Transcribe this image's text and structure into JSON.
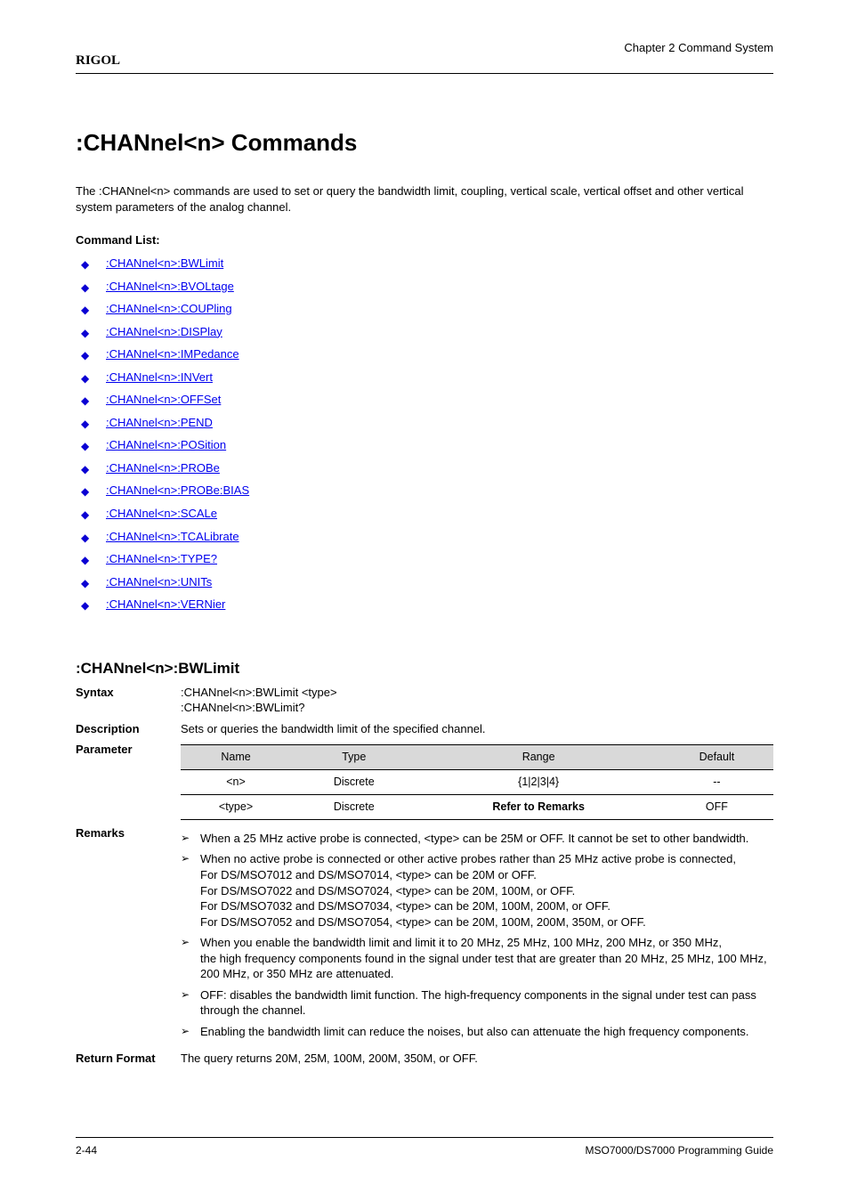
{
  "header": {
    "brand": "RIGOL",
    "chapterLabel": "Chapter 2 Command System"
  },
  "section": {
    "title": ":CHANnel<n> Commands",
    "intro": "The :CHANnel<n> commands are used to set or query the bandwidth limit, coupling, vertical scale, vertical offset and other vertical system parameters of the analog channel."
  },
  "linkHeading": "Command List:",
  "links": [
    ":CHANnel<n>:BWLimit",
    ":CHANnel<n>:BVOLtage",
    ":CHANnel<n>:COUPling",
    ":CHANnel<n>:DISPlay",
    ":CHANnel<n>:IMPedance",
    ":CHANnel<n>:INVert",
    ":CHANnel<n>:OFFSet",
    ":CHANnel<n>:PEND",
    ":CHANnel<n>:POSition",
    ":CHANnel<n>:PROBe",
    ":CHANnel<n>:PROBe:BIAS",
    ":CHANnel<n>:SCALe",
    ":CHANnel<n>:TCALibrate",
    ":CHANnel<n>:TYPE?",
    ":CHANnel<n>:UNITs",
    ":CHANnel<n>:VERNier"
  ],
  "cmdSection": {
    "title": ":CHANnel<n>:BWLimit",
    "syntaxLabel": "Syntax",
    "syntax1": ":CHANnel<n>:BWLimit <type>",
    "syntax2": ":CHANnel<n>:BWLimit?",
    "descLabel": "Description",
    "description": "Sets or queries the bandwidth limit of the specified channel.",
    "paramLabel": "Parameter",
    "paramTable": {
      "headers": [
        "Name",
        "Type",
        "Range",
        "Default"
      ],
      "rows": [
        [
          "<n>",
          "Discrete",
          "{1|2|3|4}",
          "--"
        ],
        [
          "<type>",
          "Discrete",
          "Refer to Remarks",
          "OFF"
        ]
      ]
    },
    "remarksLabel": "Remarks",
    "remarksBullets": [
      "When a 25 MHz active probe is connected, <type> can be 25M or OFF. It cannot be set to other bandwidth.",
      "When no active probe is connected or other active probes rather than 25 MHz active probe is connected,"
    ],
    "remarksNote1": "For DS/MSO7012 and DS/MSO7014, <type> can be 20M or OFF.",
    "remarksNote2": "For DS/MSO7022 and DS/MSO7024, <type> can be 20M, 100M, or OFF.",
    "remarksNote3": "For DS/MSO7032 and DS/MSO7034, <type> can be 20M, 100M, 200M, or OFF.",
    "remarksNote4": "For DS/MSO7052 and DS/MSO7054, <type> can be 20M, 100M, 200M, 350M, or OFF.",
    "remarksBullet3": "When you enable the bandwidth limit and limit it to 20 MHz, 25 MHz, 100 MHz, 200 MHz, or 350 MHz,",
    "remarksNote5": "the high frequency components found in the signal under test that are greater than 20 MHz, 25 MHz, 100 MHz, 200 MHz, or 350 MHz are attenuated.",
    "remarksBullet4": "OFF: disables the bandwidth limit function. The high-frequency components in the signal under test can pass through the channel.",
    "remarksBullet5": "Enabling the bandwidth limit can reduce the noises, but also can attenuate the high frequency components.",
    "returnLabel": "Return Format",
    "returnValue": "The query returns 20M, 25M, 100M, 200M, 350M, or OFF."
  },
  "footer": {
    "pageNum": "2-44",
    "guide": "MSO7000/DS7000 Programming Guide"
  }
}
